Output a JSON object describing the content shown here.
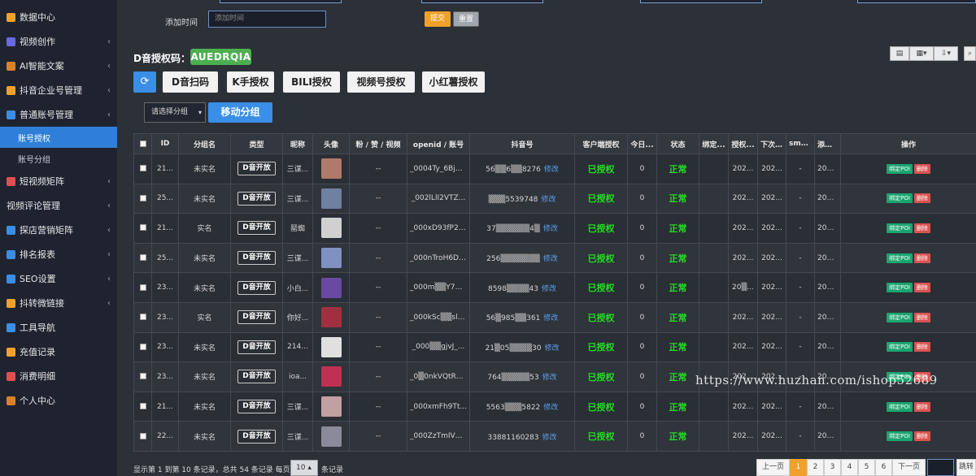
{
  "sidebar": {
    "items": [
      {
        "label": "数据中心",
        "icon": "chart-icon",
        "color": "#f0a12b",
        "arrow": ""
      },
      {
        "label": "视频创作",
        "icon": "video-icon",
        "color": "#6a6ae0",
        "arrow": "‹"
      },
      {
        "label": "AI智能文案",
        "icon": "ai-icon",
        "color": "#d9812b",
        "arrow": "‹"
      },
      {
        "label": "抖音企业号管理",
        "icon": "enterprise-icon",
        "color": "#f0a12b",
        "arrow": "‹"
      },
      {
        "label": "普通账号管理",
        "icon": "account-icon",
        "color": "#3a8ee6",
        "arrow": "‹"
      }
    ],
    "sub_items": [
      {
        "label": "账号授权",
        "active": true
      },
      {
        "label": "账号分组",
        "active": false
      }
    ],
    "items_after": [
      {
        "label": "短视频矩阵",
        "icon": "matrix-icon",
        "color": "#e05050",
        "arrow": "‹"
      },
      {
        "label": "视频评论管理",
        "icon": "",
        "color": "",
        "arrow": "‹"
      },
      {
        "label": "探店营销矩阵",
        "icon": "shop-icon",
        "color": "#3a8ee6",
        "arrow": "‹"
      },
      {
        "label": "排名报表",
        "icon": "rank-icon",
        "color": "#3a8ee6",
        "arrow": "‹"
      },
      {
        "label": "SEO设置",
        "icon": "seo-icon",
        "color": "#3a8ee6",
        "arrow": "‹"
      },
      {
        "label": "抖转微链接",
        "icon": "link-icon",
        "color": "#f0a12b",
        "arrow": "‹"
      },
      {
        "label": "工具导航",
        "icon": "tools-icon",
        "color": "#3a8ee6",
        "arrow": ""
      },
      {
        "label": "充值记录",
        "icon": "recharge-icon",
        "color": "#f0a12b",
        "arrow": ""
      },
      {
        "label": "消费明细",
        "icon": "consume-icon",
        "color": "#e05050",
        "arrow": ""
      },
      {
        "label": "个人中心",
        "icon": "user-icon",
        "color": "#d9812b",
        "arrow": ""
      }
    ]
  },
  "filter": {
    "label": "添加时间",
    "placeholder": "添加时间",
    "submit": "提交",
    "reset": "重置"
  },
  "auth": {
    "label": "D音授权码：",
    "code": "AUEDRQIA"
  },
  "platforms": [
    "D音扫码",
    "K手授权",
    "BILI授权",
    "视频号授权",
    "小红薯授权"
  ],
  "group_select": "请选择分组",
  "move_group": "移动分组",
  "table": {
    "headers": [
      "ID",
      "分组名",
      "类型",
      "昵称",
      "头像",
      "粉 / 赞 / 视频",
      "openid / 账号",
      "抖音号",
      "客户端授权",
      "今日...",
      "状态",
      "绑定...",
      "授权...",
      "下次...",
      "sms...",
      "添加...",
      "操作"
    ],
    "rows": [
      {
        "id": "21...",
        "group": "未实名",
        "type": "D音开放",
        "nick": "三谋...",
        "fans": "--",
        "openid": "_0004Ty_6Bj2...",
        "douyin": "56▒▒6▒▒8276",
        "edit": "修改",
        "auth": "已授权",
        "today": "0",
        "status": "正常",
        "bind": "",
        "authtime": "202...",
        "next": "202...",
        "sms": "-",
        "added": "202...",
        "avatar": "#b07a6a"
      },
      {
        "id": "25...",
        "group": "未实名",
        "type": "D音开放",
        "nick": "三谋...",
        "fans": "--",
        "openid": "_002lLlI2VTZ...",
        "douyin": "▒▒▒5539748",
        "edit": "修改",
        "auth": "已授权",
        "today": "0",
        "status": "正常",
        "bind": "",
        "authtime": "202...",
        "next": "202...",
        "sms": "-",
        "added": "202...",
        "avatar": "#7080a0"
      },
      {
        "id": "21...",
        "group": "实名",
        "type": "D音开放",
        "nick": "罂蜘",
        "fans": "--",
        "openid": "_000xD93fP2b...",
        "douyin": "37▒▒▒▒▒▒4▒",
        "edit": "修改",
        "auth": "已授权",
        "today": "0",
        "status": "正常",
        "bind": "",
        "authtime": "202...",
        "next": "202...",
        "sms": "-",
        "added": "202...",
        "avatar": "#d0d0d0"
      },
      {
        "id": "25...",
        "group": "未实名",
        "type": "D音开放",
        "nick": "三谋...",
        "fans": "--",
        "openid": "_000nTroH6DP...",
        "douyin": "256▒▒▒▒▒▒▒",
        "edit": "修改",
        "auth": "已授权",
        "today": "0",
        "status": "正常",
        "bind": "",
        "authtime": "202...",
        "next": "202...",
        "sms": "-",
        "added": "202...",
        "avatar": "#8090c0"
      },
      {
        "id": "23...",
        "group": "未实名",
        "type": "D音开放",
        "nick": "小白...",
        "fans": "--",
        "openid": "_000m▒▒Y7▒...",
        "douyin": "8598▒▒▒▒43",
        "edit": "修改",
        "auth": "已授权",
        "today": "0",
        "status": "正常",
        "bind": "",
        "authtime": "20▒...",
        "next": "202...",
        "sms": "-",
        "added": "202...",
        "avatar": "#6a4aa0"
      },
      {
        "id": "23...",
        "group": "实名",
        "type": "D音开放",
        "nick": "你好...",
        "fans": "--",
        "openid": "_000kSc▒▒slu...",
        "douyin": "56▒985▒▒361",
        "edit": "修改",
        "auth": "已授权",
        "today": "0",
        "status": "正常",
        "bind": "",
        "authtime": "202...",
        "next": "202...",
        "sms": "-",
        "added": "202...",
        "avatar": "#a03040"
      },
      {
        "id": "23...",
        "group": "未实名",
        "type": "D音开放",
        "nick": "214...",
        "fans": "--",
        "openid": "_000▒▒gjvJ_...",
        "douyin": "21▒05▒▒▒▒30",
        "edit": "修改",
        "auth": "已授权",
        "today": "0",
        "status": "正常",
        "bind": "",
        "authtime": "202...",
        "next": "202...",
        "sms": "-",
        "added": "202...",
        "avatar": "#e0e0e0"
      },
      {
        "id": "23...",
        "group": "未实名",
        "type": "D音开放",
        "nick": "ioa...",
        "fans": "--",
        "openid": "_0▒0nkVQtRa4...",
        "douyin": "764▒▒▒▒▒53",
        "edit": "修改",
        "auth": "已授权",
        "today": "0",
        "status": "正常",
        "bind": "",
        "authtime": "202...",
        "next": "202...",
        "sms": "-",
        "added": "202...",
        "avatar": "#c03050"
      },
      {
        "id": "21...",
        "group": "未实名",
        "type": "D音开放",
        "nick": "三谋...",
        "fans": "--",
        "openid": "_000xmFh9Tt...",
        "douyin": "5563▒▒▒5822",
        "edit": "修改",
        "auth": "已授权",
        "today": "0",
        "status": "正常",
        "bind": "",
        "authtime": "202...",
        "next": "202...",
        "sms": "-",
        "added": "202...",
        "avatar": "#c0a0a0"
      },
      {
        "id": "22...",
        "group": "未实名",
        "type": "D音开放",
        "nick": "三谋...",
        "fans": "--",
        "openid": "_000ZzTmIVB...",
        "douyin": "33881160283",
        "edit": "修改",
        "auth": "已授权",
        "today": "0",
        "status": "正常",
        "bind": "",
        "authtime": "202...",
        "next": "202...",
        "sms": "-",
        "added": "202...",
        "avatar": "#8a8a9a"
      }
    ],
    "op_bind": "绑定POI",
    "op_delete": "删除"
  },
  "footer": {
    "summary": "显示第 1 到第 10 条记录，总共 54 条记录 每页显示",
    "page_size": "10",
    "suffix": "条记录",
    "prev": "上一页",
    "pages": [
      "1",
      "2",
      "3",
      "4",
      "5",
      "6"
    ],
    "next": "下一页",
    "jump": "跳转"
  },
  "watermark": "https://www.huzhan.com/ishop52689"
}
